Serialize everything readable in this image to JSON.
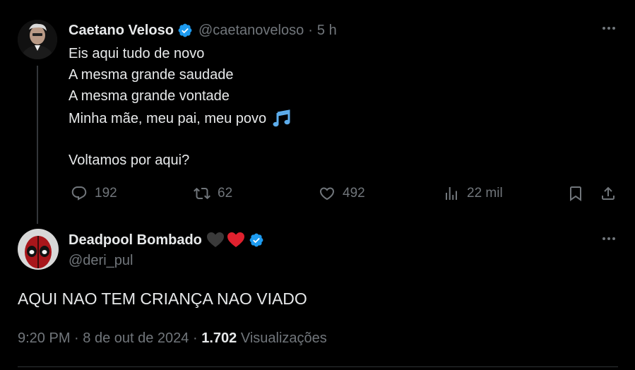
{
  "tweet": {
    "author_name": "Caetano Veloso",
    "handle": "@caetanoveloso",
    "separator": "·",
    "time": "5 h",
    "lines": [
      "Eis aqui tudo de novo",
      "A mesma grande saudade",
      "A mesma grande vontade",
      "Minha mãe, meu pai, meu povo",
      "Voltamos por aqui?"
    ],
    "actions": {
      "replies": "192",
      "retweets": "62",
      "likes": "492",
      "views": "22 mil"
    },
    "icons": [
      "verified-badge-icon",
      "music-notes-icon",
      "reply-icon",
      "retweet-icon",
      "like-icon",
      "views-icon",
      "bookmark-icon",
      "share-icon",
      "more-icon"
    ]
  },
  "reply": {
    "author_name": "Deadpool Bombado",
    "handle": "@deri_pul",
    "text": "AQUI NAO TEM CRIANÇA NAO VIADO",
    "time": "9:20 PM",
    "separator": "·",
    "date": "8 de out de 2024",
    "views_count": "1.702",
    "views_label": "Visualizações",
    "icons": [
      "black-heart-icon",
      "red-heart-icon",
      "verified-badge-icon",
      "more-icon"
    ]
  },
  "colors": {
    "background": "#000000",
    "text": "#e7e9ea",
    "secondary": "#71767b",
    "verified": "#1d9bf0",
    "heart": "#f91880"
  }
}
